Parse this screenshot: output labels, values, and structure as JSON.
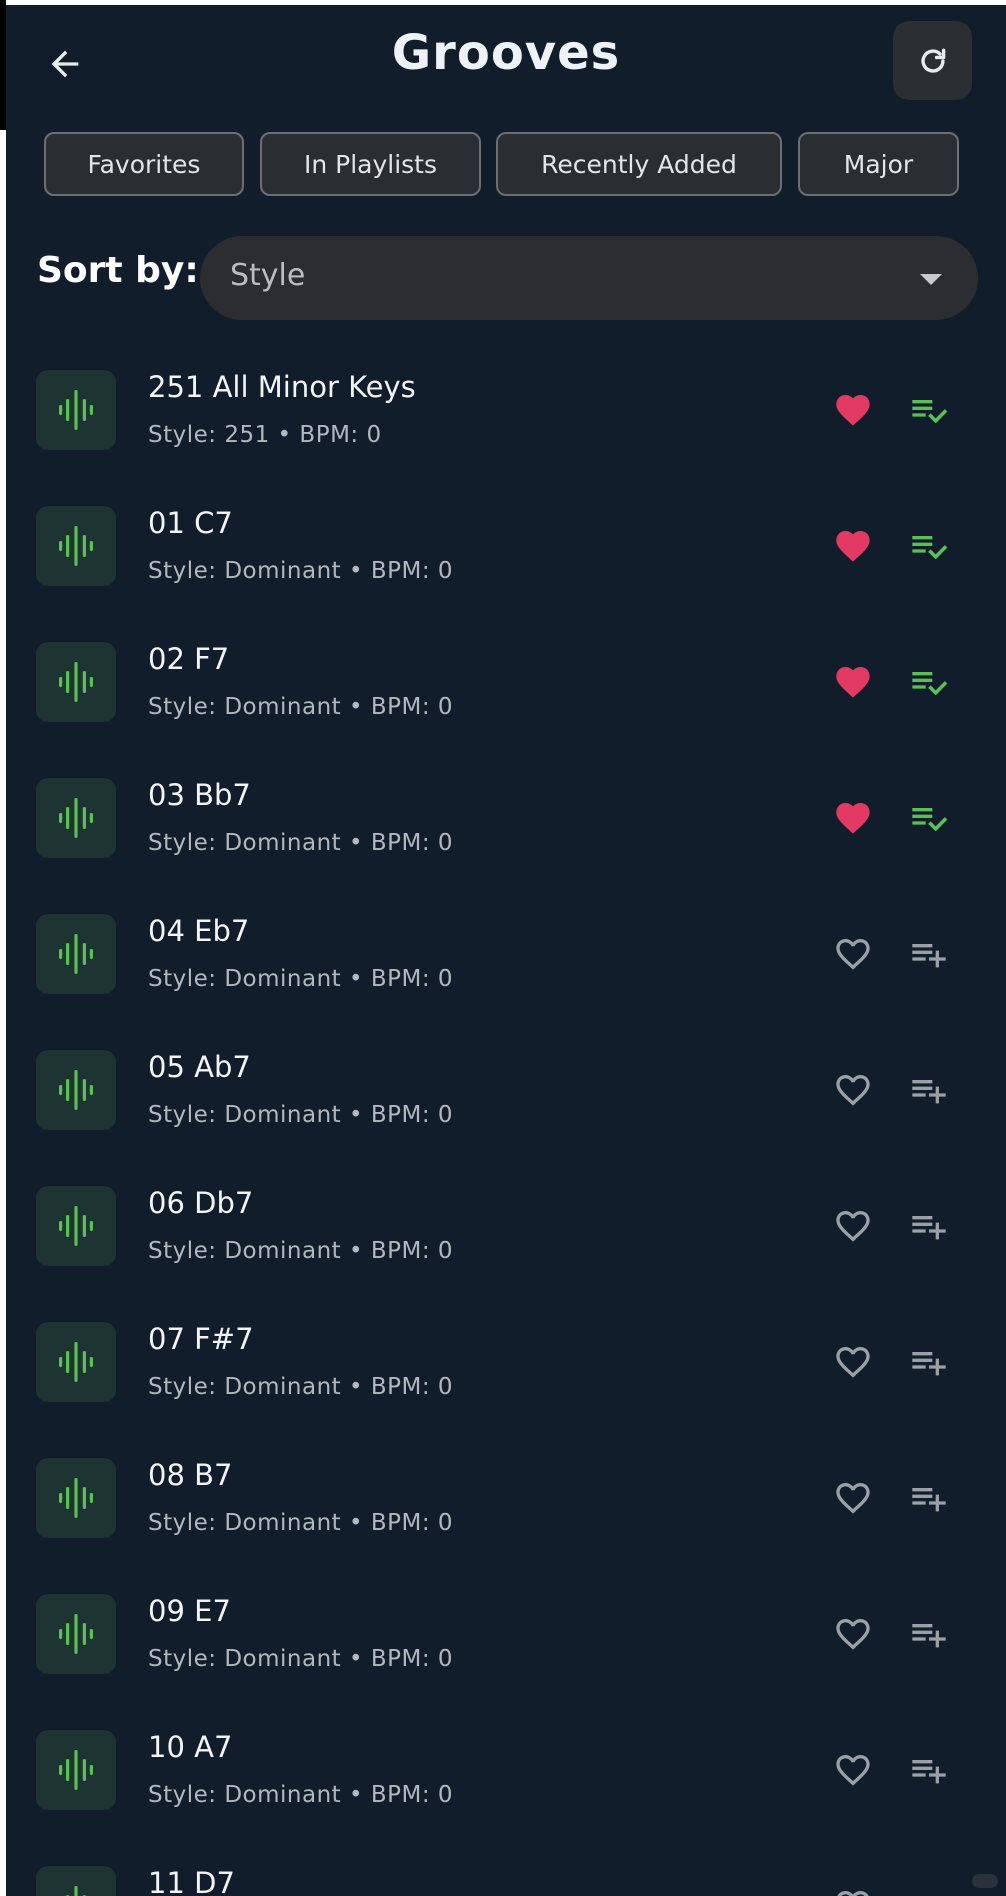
{
  "header": {
    "title": "Grooves"
  },
  "filters": [
    {
      "label": "Favorites"
    },
    {
      "label": "In Playlists"
    },
    {
      "label": "Recently Added"
    },
    {
      "label": "Major"
    }
  ],
  "sort": {
    "label": "Sort by:",
    "value": "Style"
  },
  "colors": {
    "background": "#121d2b",
    "accent_green": "#5cbf55",
    "favorite_pink": "#e33a63",
    "muted_icon": "#9aa0a6"
  },
  "items": [
    {
      "title": "251 All Minor Keys",
      "subtitle": "Style: 251 • BPM: 0",
      "favorite": true,
      "in_playlist": true
    },
    {
      "title": "01 C7",
      "subtitle": "Style: Dominant • BPM: 0",
      "favorite": true,
      "in_playlist": true
    },
    {
      "title": "02 F7",
      "subtitle": "Style: Dominant • BPM: 0",
      "favorite": true,
      "in_playlist": true
    },
    {
      "title": "03 Bb7",
      "subtitle": "Style: Dominant • BPM: 0",
      "favorite": true,
      "in_playlist": true
    },
    {
      "title": "04 Eb7",
      "subtitle": "Style: Dominant • BPM: 0",
      "favorite": false,
      "in_playlist": false
    },
    {
      "title": "05 Ab7",
      "subtitle": "Style: Dominant • BPM: 0",
      "favorite": false,
      "in_playlist": false
    },
    {
      "title": "06 Db7",
      "subtitle": "Style: Dominant • BPM: 0",
      "favorite": false,
      "in_playlist": false
    },
    {
      "title": "07 F#7",
      "subtitle": "Style: Dominant • BPM: 0",
      "favorite": false,
      "in_playlist": false
    },
    {
      "title": "08 B7",
      "subtitle": "Style: Dominant • BPM: 0",
      "favorite": false,
      "in_playlist": false
    },
    {
      "title": "09 E7",
      "subtitle": "Style: Dominant • BPM: 0",
      "favorite": false,
      "in_playlist": false
    },
    {
      "title": "10 A7",
      "subtitle": "Style: Dominant • BPM: 0",
      "favorite": false,
      "in_playlist": false
    },
    {
      "title": "11 D7",
      "subtitle": "",
      "favorite": false,
      "in_playlist": false
    }
  ]
}
